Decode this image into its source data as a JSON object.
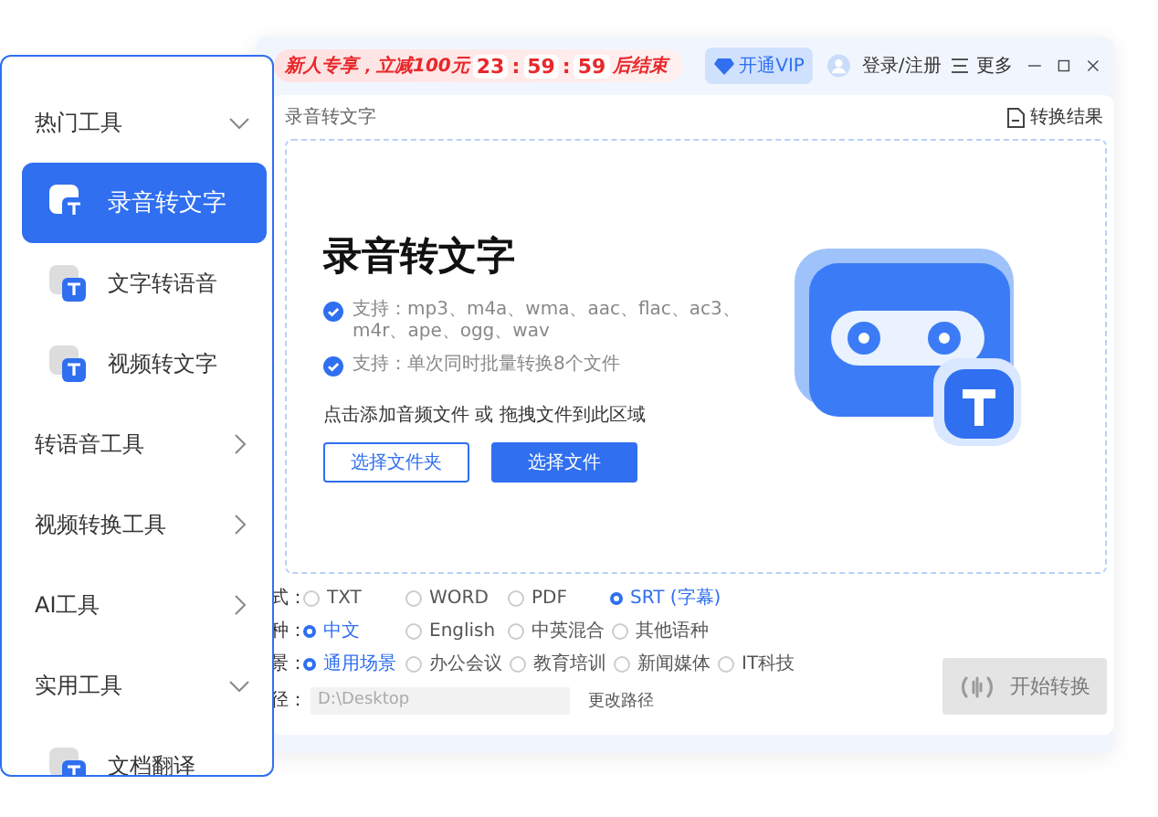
{
  "promo": {
    "text": "新人专享，立减100元",
    "countdown": [
      "23",
      ":",
      "59",
      ":",
      "59"
    ],
    "suffix": "后结束"
  },
  "header": {
    "vip": "开通VIP",
    "login": "登录/注册",
    "more": "更多"
  },
  "breadcrumb": "录音转文字",
  "results_link": "转换结果",
  "drop": {
    "title": "录音转文字",
    "features": [
      "支持：mp3、m4a、wma、aac、flac、ac3、m4r、ape、ogg、wav",
      "支持：单次同时批量转换8个文件"
    ],
    "hint": "点击添加音频文件 或 拖拽文件到此区域",
    "buttons": [
      {
        "label": "选择文件夹",
        "kind": "outline"
      },
      {
        "label": "选择文件",
        "kind": "primary"
      }
    ]
  },
  "options": [
    {
      "label": "式：",
      "choices": [
        {
          "label": "TXT",
          "selected": false
        },
        {
          "label": "WORD",
          "selected": false
        },
        {
          "label": "PDF",
          "selected": false
        },
        {
          "label": "SRT (字幕)",
          "selected": true
        }
      ]
    },
    {
      "label": "种：",
      "choices": [
        {
          "label": "中文",
          "selected": true
        },
        {
          "label": "English",
          "selected": false
        },
        {
          "label": "中英混合",
          "selected": false
        },
        {
          "label": "其他语种",
          "selected": false
        }
      ]
    },
    {
      "label": "景：",
      "choices": [
        {
          "label": "通用场景",
          "selected": true
        },
        {
          "label": "办公会议",
          "selected": false
        },
        {
          "label": "教育培训",
          "selected": false
        },
        {
          "label": "新闻媒体",
          "selected": false
        },
        {
          "label": "IT科技",
          "selected": false
        }
      ]
    }
  ],
  "path": {
    "label": "径：",
    "value": "D:\\Desktop",
    "action": "更改路径"
  },
  "start_button": {
    "label": "开始转换",
    "disabled": true
  },
  "sidebar": {
    "groups": [
      {
        "label": "热门工具",
        "expanded": true,
        "children": [
          {
            "label": "录音转文字",
            "selected": true
          },
          {
            "label": "文字转语音",
            "selected": false
          },
          {
            "label": "视频转文字",
            "selected": false
          }
        ]
      },
      {
        "label": "转语音工具",
        "expanded": false
      },
      {
        "label": "视频转换工具",
        "expanded": false
      },
      {
        "label": "AI工具",
        "expanded": false
      },
      {
        "label": "实用工具",
        "expanded": true,
        "children": [
          {
            "label": "文档翻译",
            "selected": false
          }
        ]
      }
    ]
  }
}
